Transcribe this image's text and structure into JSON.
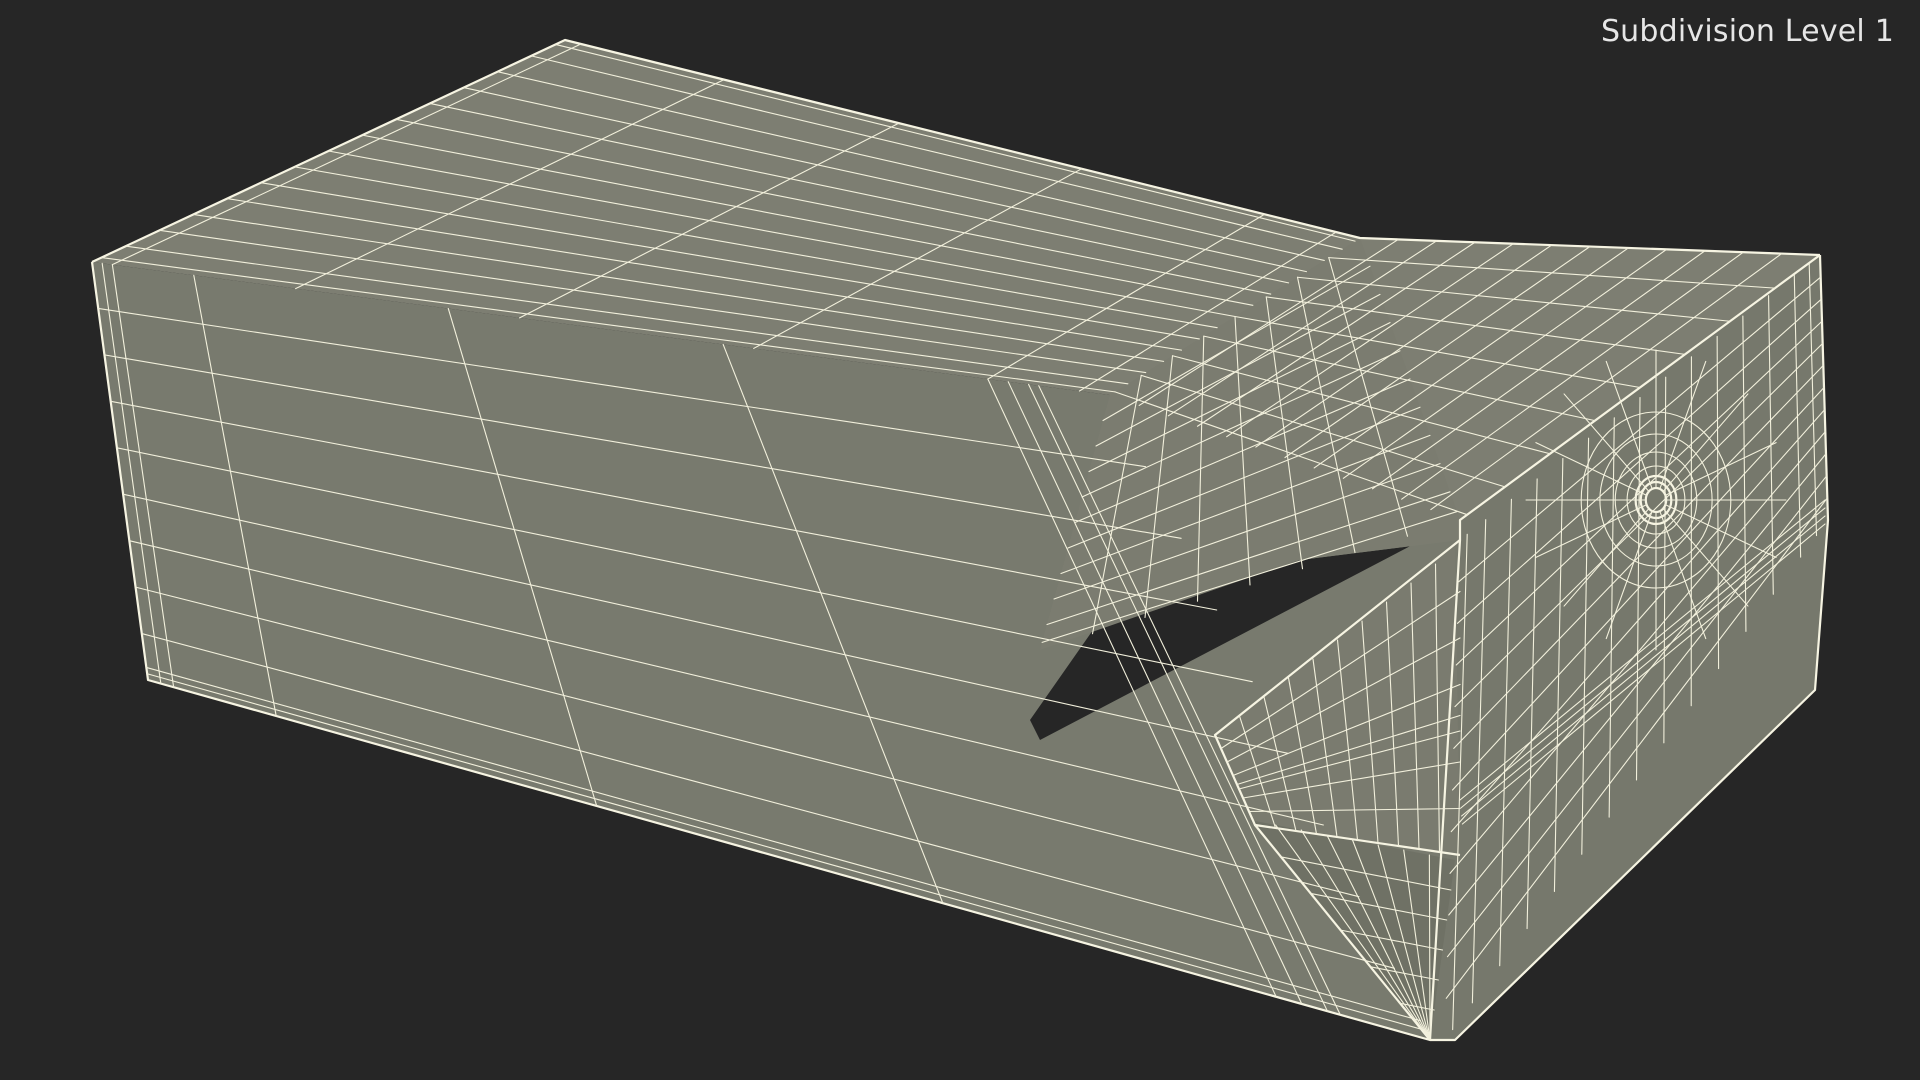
{
  "viewport": {
    "label": "Subdivision Level 1",
    "background_color": "#262626",
    "mesh_fill_color": "#7b7c70",
    "wire_color": "#f2f0dc"
  }
}
